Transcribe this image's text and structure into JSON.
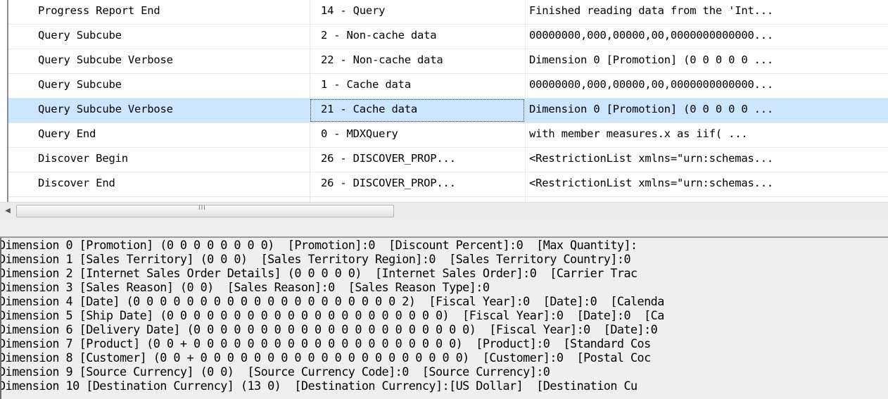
{
  "trace_grid": {
    "rows": [
      {
        "event_class": "Progress Report End",
        "event_subclass": "14 - Query",
        "text_data": "Finished reading data from the 'Int..."
      },
      {
        "event_class": "Query Subcube",
        "event_subclass": "2 - Non-cache data",
        "text_data": "00000000,000,00000,00,0000000000000..."
      },
      {
        "event_class": "Query Subcube Verbose",
        "event_subclass": "22 - Non-cache data",
        "text_data": "Dimension 0 [Promotion] (0 0 0 0 0 ..."
      },
      {
        "event_class": "Query Subcube",
        "event_subclass": "1 - Cache data",
        "text_data": "00000000,000,00000,00,0000000000000..."
      },
      {
        "event_class": "Query Subcube Verbose",
        "event_subclass": "21 - Cache data",
        "text_data": "Dimension 0 [Promotion] (0 0 0 0 0 ..."
      },
      {
        "event_class": "Query End",
        "event_subclass": "0 - MDXQuery",
        "text_data": "with member measures.x as  iif(    ..."
      },
      {
        "event_class": "Discover Begin",
        "event_subclass": "26 - DISCOVER_PROP...",
        "text_data": "<RestrictionList xmlns=\"urn:schemas..."
      },
      {
        "event_class": "Discover End",
        "event_subclass": "26 - DISCOVER_PROP...",
        "text_data": "<RestrictionList xmlns=\"urn:schemas..."
      }
    ],
    "selected_row": 4,
    "scrollbar_grip": "III"
  },
  "text_pane": {
    "lines": [
      "Dimension 0 [Promotion] (0 0 0 0 0 0 0 0)  [Promotion]:0  [Discount Percent]:0  [Max Quantity]:",
      "Dimension 1 [Sales Territory] (0 0 0)  [Sales Territory Region]:0  [Sales Territory Country]:0",
      "Dimension 2 [Internet Sales Order Details] (0 0 0 0 0)  [Internet Sales Order]:0  [Carrier Trac",
      "Dimension 3 [Sales Reason] (0 0)  [Sales Reason]:0  [Sales Reason Type]:0",
      "Dimension 4 [Date] (0 0 0 0 0 0 0 0 0 0 0 0 0 0 0 0 0 0 0 0 2)  [Fiscal Year]:0  [Date]:0  [Calenda",
      "Dimension 5 [Ship Date] (0 0 0 0 0 0 0 0 0 0 0 0 0 0 0 0 0 0 0 0 0)  [Fiscal Year]:0  [Date]:0  [Ca",
      "Dimension 6 [Delivery Date] (0 0 0 0 0 0 0 0 0 0 0 0 0 0 0 0 0 0 0 0 0)  [Fiscal Year]:0  [Date]:0",
      "Dimension 7 [Product] (0 0 + 0 0 0 0 0 0 0 0 0 0 0 0 0 0 0 0 0 0 0 0)  [Product]:0  [Standard Cos",
      "Dimension 8 [Customer] (0 0 + 0 0 0 0 0 0 0 0 0 0 0 0 0 0 0 0 0 0 0 0)  [Customer]:0  [Postal Coc",
      "Dimension 9 [Source Currency] (0 0)  [Source Currency Code]:0  [Source Currency]:0",
      "Dimension 10 [Destination Currency] (13 0)  [Destination Currency]:[US Dollar]  [Destination Cu"
    ]
  },
  "colors": {
    "selected_row_bg": "#cce6ff",
    "grid_bg": "#ffffff",
    "text_pane_bg": "#efefef"
  }
}
